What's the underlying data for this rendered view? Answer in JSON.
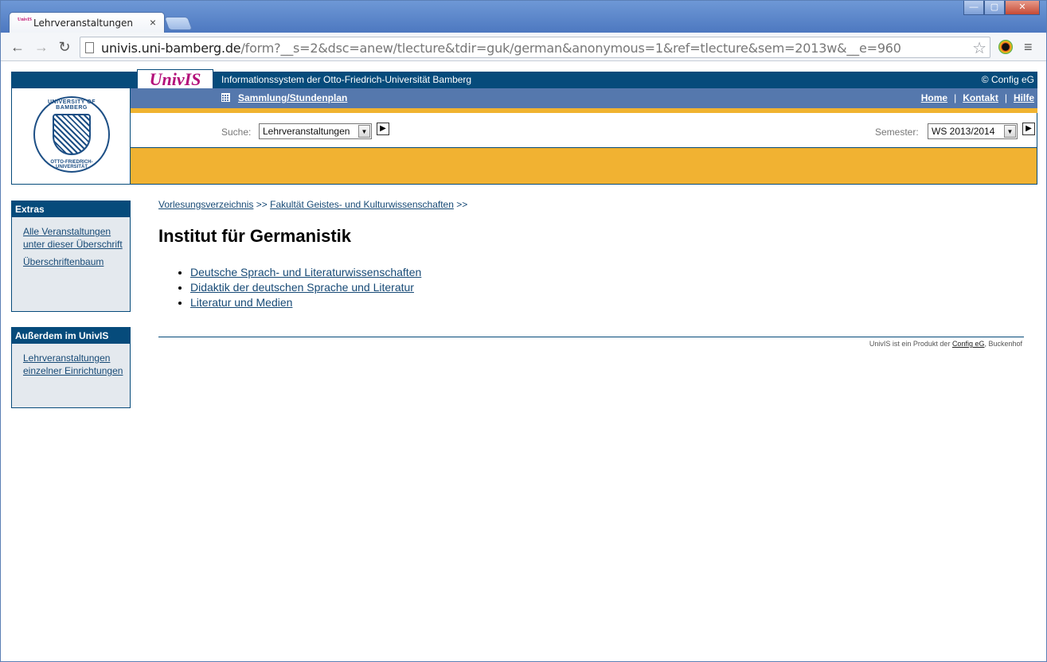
{
  "browser": {
    "tab_title": "Lehrveranstaltungen",
    "tab_favicon": "UnivIS",
    "close_icon": "×",
    "url_host": "univis.uni-bamberg.de",
    "url_path": "/form?__s=2&dsc=anew/tlecture&tdir=guk/german&anonymous=1&ref=tlecture&sem=2013w&__e=960",
    "back_icon": "←",
    "forward_icon": "→",
    "reload_icon": "↻",
    "star_icon": "☆",
    "menu_icon": "≡",
    "window_buttons": [
      "—",
      "▢",
      "✕"
    ]
  },
  "header": {
    "univis_logo": "UnivIS",
    "title": "Informationssystem der Otto-Friedrich-Universität Bamberg",
    "copyright": "© Config eG",
    "collection_link": "Sammlung/Stundenplan",
    "nav": [
      "Home",
      "Kontakt",
      "Hilfe"
    ],
    "nav_separator": "|",
    "search_label": "Suche:",
    "search_value": "Lehrveranstaltungen",
    "semester_label": "Semester:",
    "semester_value": "WS 2013/2014",
    "dropdown_arrow": "▼",
    "go_arrow": "▶"
  },
  "seal": {
    "top_text": "UNIVERSITY OF BAMBERG",
    "bottom_text": "OTTO-FRIEDRICH-UNIVERSITÄT"
  },
  "sidebar": {
    "extras_title": "Extras",
    "extras_links": [
      "Alle Veranstaltungen unter dieser Überschrift",
      "Überschriftenbaum"
    ],
    "more_title": "Außerdem im UnivIS",
    "more_links": [
      "Lehrveranstaltungen einzelner Einrichtungen"
    ]
  },
  "main": {
    "breadcrumb": [
      "Vorlesungsverzeichnis",
      "Fakultät Geistes- und Kulturwissenschaften"
    ],
    "breadcrumb_sep": ">>",
    "heading": "Institut für Germanistik",
    "items": [
      "Deutsche Sprach- und Literaturwissenschaften",
      "Didaktik der deutschen Sprache und Literatur",
      "Literatur und Medien"
    ],
    "footer_text_before": "UnivIS ist ein Produkt der ",
    "footer_link": "Config eG",
    "footer_text_after": ", Buckenhof"
  },
  "colors": {
    "navy": "#064b7b",
    "header_blue": "#5578ad",
    "orange": "#f1b232",
    "sidebar_bg": "#e4e9ee",
    "logo_magenta": "#b3107a"
  }
}
